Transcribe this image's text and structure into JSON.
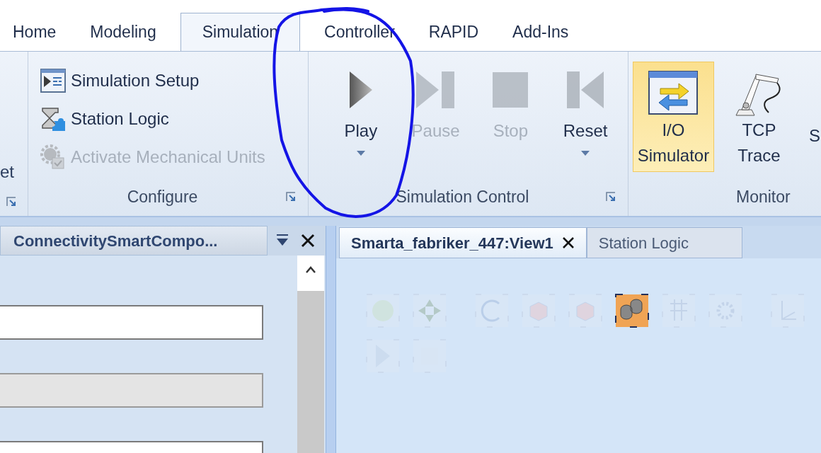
{
  "ribbon_tabs": [
    {
      "label": "Home",
      "selected": false
    },
    {
      "label": "Modeling",
      "selected": false
    },
    {
      "label": "Simulation",
      "selected": true
    },
    {
      "label": "Controller",
      "selected": false
    },
    {
      "label": "RAPID",
      "selected": false
    },
    {
      "label": "Add-Ins",
      "selected": false
    }
  ],
  "left_group_fragment": {
    "text": "et"
  },
  "configure": {
    "label": "Configure",
    "items": [
      {
        "kind": "setup",
        "label": "Simulation Setup",
        "disabled": false
      },
      {
        "kind": "logic",
        "label": "Station Logic",
        "disabled": false
      },
      {
        "kind": "units",
        "label": "Activate Mechanical Units",
        "disabled": true
      }
    ]
  },
  "simulation_control": {
    "label": "Simulation Control",
    "buttons": [
      {
        "kind": "play",
        "label": "Play",
        "disabled": false,
        "dropdown": true
      },
      {
        "kind": "pause",
        "label": "Pause",
        "disabled": true,
        "dropdown": false
      },
      {
        "kind": "stop",
        "label": "Stop",
        "disabled": true,
        "dropdown": false
      },
      {
        "kind": "reset",
        "label": "Reset",
        "disabled": false,
        "dropdown": true
      }
    ]
  },
  "monitor": {
    "label": "Monitor",
    "buttons": [
      {
        "kind": "io",
        "label": "I/O Simulator",
        "selected": true
      },
      {
        "kind": "trace",
        "label": "TCP Trace",
        "selected": false
      },
      {
        "kind": "cut",
        "label": "S",
        "selected": false
      }
    ]
  },
  "properties_panel": {
    "title": "ConnectivitySmartCompo...",
    "fields": [
      {
        "disabled": false
      },
      {
        "disabled": true
      },
      {
        "disabled": false
      }
    ]
  },
  "document_tabs": [
    {
      "label": "Smarta_fabriker_447:View1",
      "selected": true,
      "closable": true
    },
    {
      "label": "Station Logic",
      "selected": false,
      "closable": false
    }
  ],
  "view_toolbar": [
    {
      "kind": "circle",
      "on": false
    },
    {
      "kind": "fit",
      "on": false
    },
    {
      "kind": "orbit",
      "on": false
    },
    {
      "kind": "cube",
      "on": false
    },
    {
      "kind": "cube",
      "on": false
    },
    {
      "kind": "parts",
      "on": true
    },
    {
      "kind": "grid",
      "on": false
    },
    {
      "kind": "gear",
      "on": false
    },
    {
      "kind": "axes",
      "on": false
    }
  ],
  "view_toolbar_row2": [
    {
      "kind": "play",
      "on": false
    },
    {
      "kind": "stop",
      "on": false
    }
  ]
}
